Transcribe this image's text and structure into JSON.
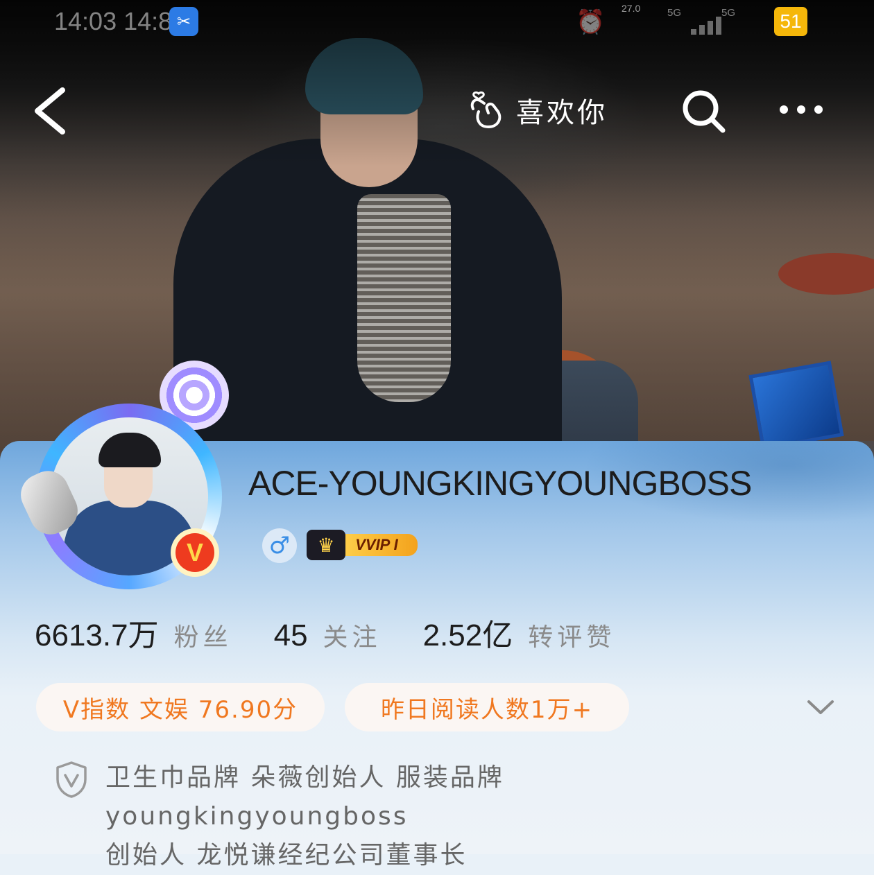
{
  "status_bar": {
    "time": "14:03 14:8",
    "network_speed": "27.0",
    "signal_1": "5G",
    "signal_2": "5G",
    "battery": "51"
  },
  "nav": {
    "like_label": "喜欢你"
  },
  "profile": {
    "username": "ACE-YOUNGKINGYOUNGBOSS",
    "gender_symbol": "♂",
    "vip_label": "VVIP I",
    "verified_badge": "V"
  },
  "stats": [
    {
      "value": "6613.7万",
      "label": "粉丝"
    },
    {
      "value": "45",
      "label": "关注"
    },
    {
      "value": "2.52亿",
      "label": "转评赞"
    }
  ],
  "chips": {
    "v_index": "V指数 文娱 76.90分",
    "reads": "昨日阅读人数1万+"
  },
  "bio": {
    "line1": "卫生巾品牌 朵薇创始人 服装品牌youngkingyoungboss",
    "line2": "创始人 龙悦谦经纪公司董事长"
  },
  "colors": {
    "accent_orange": "#f07820",
    "verified_red": "#ee3b1f",
    "vip_gold": "#ffd34f"
  }
}
